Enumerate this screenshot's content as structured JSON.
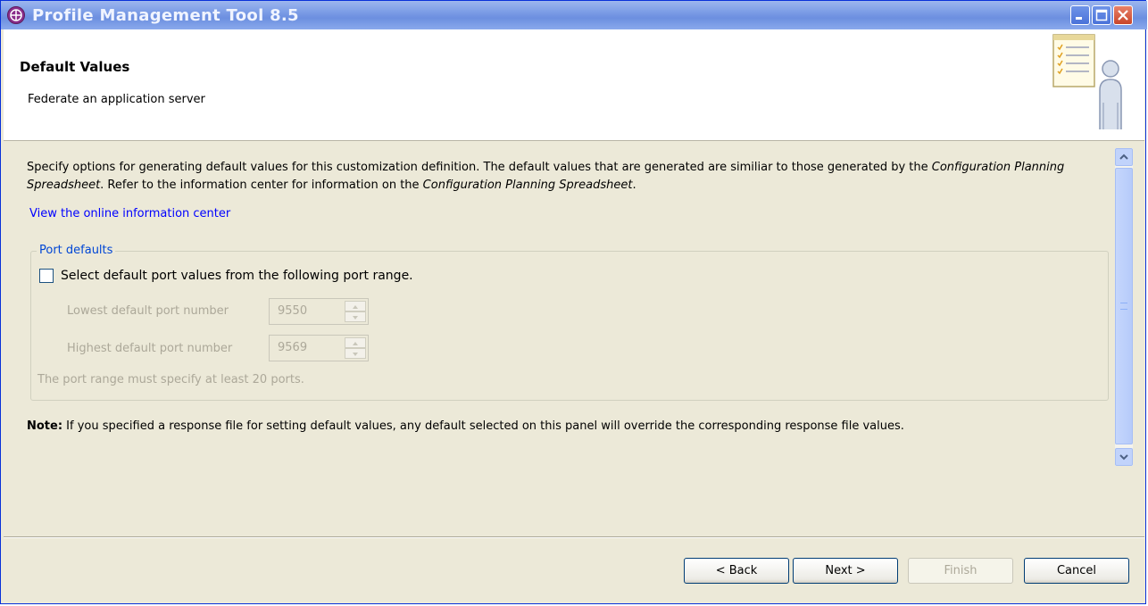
{
  "window": {
    "title": "Profile Management Tool 8.5",
    "controls": [
      "minimize-icon",
      "maximize-icon",
      "close-icon"
    ]
  },
  "banner": {
    "title": "Default Values",
    "subtitle": "Federate an application server",
    "icon": "checklist-person-icon"
  },
  "content": {
    "description_part1": "Specify options for generating default values for this customization definition. The default values that are generated are similiar to those generated by the ",
    "description_em1": "Configuration Planning Spreadsheet",
    "description_part2": ". Refer to the information center for information on the ",
    "description_em2": "Configuration Planning Spreadsheet",
    "description_part3": ".",
    "link": "View the online information center",
    "port_defaults": {
      "group_label": "Port defaults",
      "checkbox_label": "Select default port values from the following port range.",
      "checkbox_checked": false,
      "lowest_label": "Lowest default port number",
      "lowest_value": "9550",
      "highest_label": "Highest default port number",
      "highest_value": "9569",
      "hint": "The port range must specify at least 20 ports."
    },
    "note_bold": "Note:",
    "note_text": " If you specified a response file for setting default values, any default selected on this panel will override the corresponding response file values."
  },
  "buttons": {
    "back": "< Back",
    "next": "Next >",
    "finish": "Finish",
    "cancel": "Cancel"
  },
  "colors": {
    "titlebar": "#7b9ce6",
    "dialog_bg": "#ece9d8",
    "link": "#0000ff",
    "group_label": "#0046d5",
    "disabled_text": "#aca899"
  }
}
